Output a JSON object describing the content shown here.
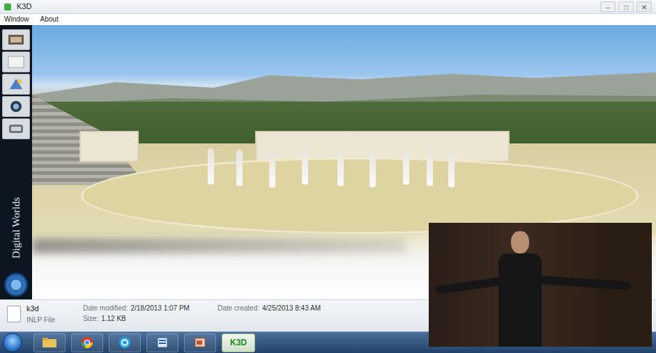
{
  "window": {
    "title": "K3D",
    "controls": [
      "–",
      "□",
      "✕"
    ]
  },
  "menu": [
    "Window",
    "About"
  ],
  "logo": {
    "text": "Digital Worlds"
  },
  "file_details": {
    "name": "k3d",
    "type": "INLP File",
    "modified_label": "Date modified:",
    "modified": "2/18/2013 1:07 PM",
    "size_label": "Size:",
    "size": "1.12 KB",
    "created_label": "Date created:",
    "created": "4/25/2013 8:43 AM"
  },
  "taskbar": {
    "apps": [
      {
        "label": "K3D",
        "selected": true
      }
    ]
  }
}
